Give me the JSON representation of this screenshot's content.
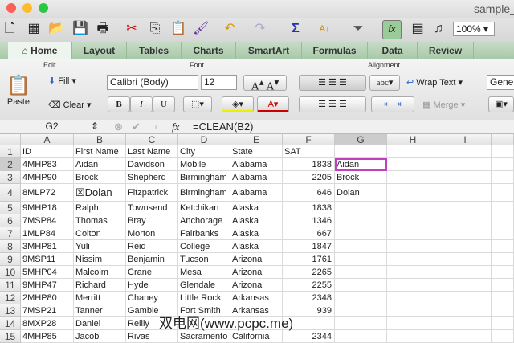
{
  "window": {
    "title": "sample_"
  },
  "toolbar": {
    "zoom": "100%"
  },
  "tabs": [
    "Home",
    "Layout",
    "Tables",
    "Charts",
    "SmartArt",
    "Formulas",
    "Data",
    "Review"
  ],
  "ribbon": {
    "edit_label": "Edit",
    "font_label": "Font",
    "alignment_label": "Alignment",
    "paste": "Paste",
    "fill": "Fill",
    "clear": "Clear",
    "font_name": "Calibri (Body)",
    "font_size": "12",
    "bold": "B",
    "italic": "I",
    "underline": "U",
    "abc": "abc",
    "wrap_text": "Wrap Text",
    "merge": "Merge",
    "number_format": "Gener"
  },
  "formula_bar": {
    "name_box": "G2",
    "fx": "fx",
    "formula": "=CLEAN(B2)"
  },
  "columns": [
    "A",
    "B",
    "C",
    "D",
    "E",
    "F",
    "G",
    "H",
    "I"
  ],
  "rows": [
    [
      "ID",
      "First Name",
      "Last Name",
      "City",
      "State",
      "SAT",
      ""
    ],
    [
      "4MHP83",
      "Aidan",
      "Davidson",
      "Mobile",
      "Alabama",
      "1838",
      "Aidan"
    ],
    [
      "4MHP90",
      " Brock",
      "Shepherd",
      "Birmingham",
      "Alabama",
      "2205",
      "Brock"
    ],
    [
      "8MLP72",
      "☒Dolan",
      "Fitzpatrick",
      "Birmingham",
      "Alabama",
      "646",
      "Dolan"
    ],
    [
      "9MHP18",
      "Ralph",
      "Townsend",
      "Ketchikan",
      "Alaska",
      "1838",
      ""
    ],
    [
      "7MSP84",
      "Thomas",
      "Bray",
      "Anchorage",
      "Alaska",
      "1346",
      ""
    ],
    [
      "1MLP84",
      "Colton",
      "Morton",
      "Fairbanks",
      "Alaska",
      "667",
      ""
    ],
    [
      "3MHP81",
      "Yuli",
      "Reid",
      "College",
      "Alaska",
      "1847",
      ""
    ],
    [
      "9MSP11",
      "Nissim",
      "Benjamin",
      "Tucson",
      "Arizona",
      "1761",
      ""
    ],
    [
      "5MHP04",
      "Malcolm",
      "Crane",
      "Mesa",
      "Arizona",
      "2265",
      ""
    ],
    [
      "9MHP47",
      "Richard",
      "Hyde",
      "Glendale",
      "Arizona",
      "2255",
      ""
    ],
    [
      "2MHP80",
      "Merritt",
      "Chaney",
      "Little Rock",
      "Arkansas",
      "2348",
      ""
    ],
    [
      "7MSP21",
      "Tanner",
      "Gamble",
      "Fort Smith",
      "Arkansas",
      "939",
      ""
    ],
    [
      "8MXP28",
      "Daniel",
      "Reilly",
      "",
      "",
      "",
      ""
    ],
    [
      "4MHP85",
      "Jacob",
      "Rivas",
      "Sacramento",
      "California",
      "2344",
      ""
    ]
  ],
  "watermark": "双电网(www.pcpc.me)",
  "colors": {
    "tab_bar": "#b5d2b5",
    "selection": "#c040c0"
  }
}
